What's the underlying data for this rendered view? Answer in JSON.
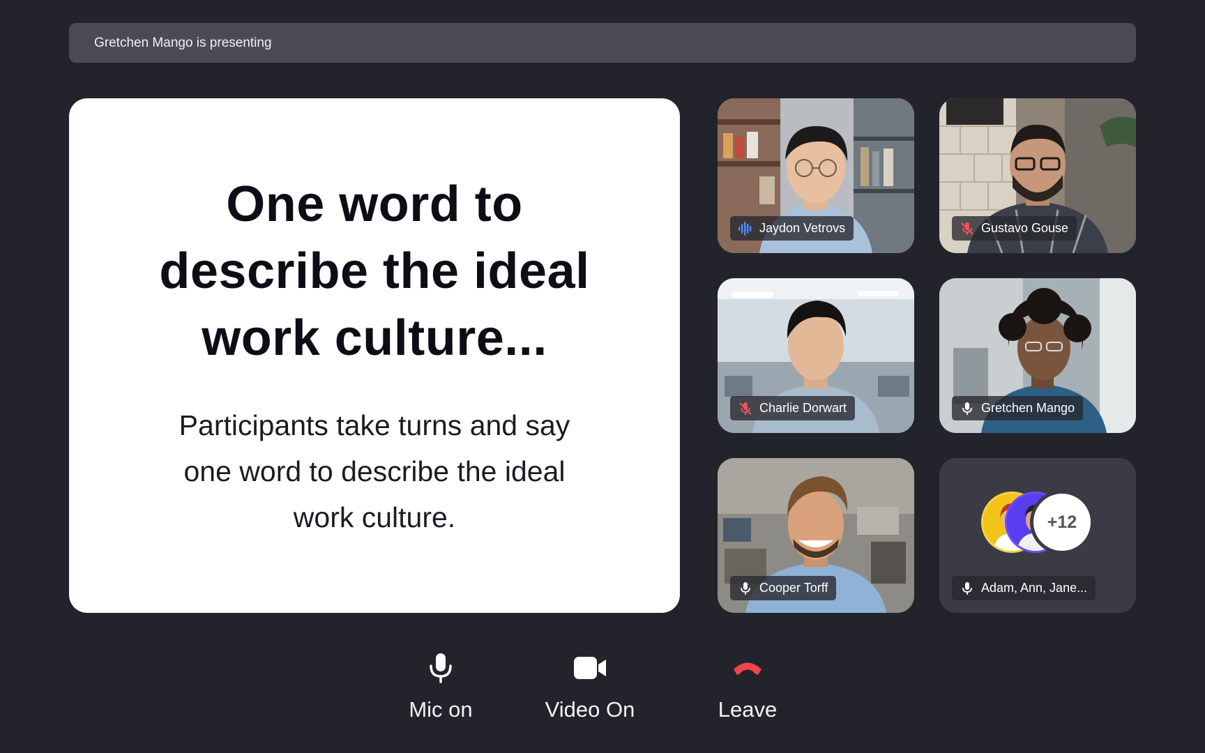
{
  "banner": {
    "text": "Gretchen Mango is presenting"
  },
  "slide": {
    "title": "One word to describe the ideal work culture...",
    "body": "Participants take turns and say one word to describe the ideal work culture."
  },
  "participants": [
    {
      "name": "Jaydon Vetrovs",
      "status_icon": "speaking-wave-icon"
    },
    {
      "name": "Gustavo Gouse",
      "status_icon": "mic-muted-icon"
    },
    {
      "name": "Charlie Dorwart",
      "status_icon": "mic-muted-icon"
    },
    {
      "name": "Gretchen Mango",
      "status_icon": "mic-icon"
    },
    {
      "name": "Cooper Torff",
      "status_icon": "mic-icon"
    }
  ],
  "group_tile": {
    "name": "Adam, Ann, Jane...",
    "overflow_count": "+12",
    "status_icon": "mic-icon"
  },
  "controls": {
    "mic_label": "Mic on",
    "video_label": "Video On",
    "leave_label": "Leave"
  },
  "colors": {
    "background": "#22232b",
    "banner": "#4a4b55",
    "speaking": "#4a8cff",
    "muted": "#ff4d55",
    "leave": "#f0454d"
  }
}
